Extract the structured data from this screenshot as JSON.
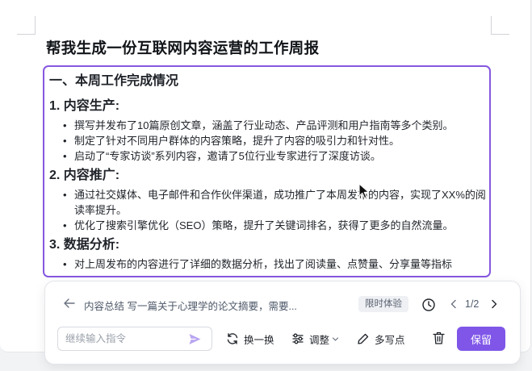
{
  "document": {
    "title": "帮我生成一份互联网内容运营的工作周报",
    "section_heading": "一、本周工作完成情况",
    "subsections": [
      {
        "heading": "1. 内容生产:",
        "bullets": [
          "撰写并发布了10篇原创文章，涵盖了行业动态、产品评测和用户指南等多个类别。",
          "制定了针对不同用户群体的内容策略，提升了内容的吸引力和针对性。",
          "启动了“专家访谈”系列内容，邀请了5位行业专家进行了深度访谈。"
        ]
      },
      {
        "heading": "2. 内容推广:",
        "bullets": [
          "通过社交媒体、电子邮件和合作伙伴渠道，成功推广了本周发布的内容，实现了XX%的阅读率提升。",
          "优化了搜索引擎优化（SEO）策略，提升了关键词排名，获得了更多的自然流量。"
        ]
      },
      {
        "heading": "3. 数据分析:",
        "bullets": [
          "对上周发布的内容进行了详细的数据分析，找出了阅读量、点赞量、分享量等指标"
        ]
      }
    ]
  },
  "ai_panel": {
    "prompt_preview": "内容总结 写一篇关于心理学的论文摘要，需要...",
    "badge": "限时体验",
    "pager": "1/2",
    "input_placeholder": "继续输入指令",
    "actions": {
      "rewrite": "换一换",
      "adjust": "调整",
      "more": "多写点",
      "save": "保留"
    }
  },
  "colors": {
    "accent": "#7f56e8",
    "selection_border": "#8657e0"
  },
  "icons": [
    "back-arrow-icon",
    "history-clock-icon",
    "chevron-left-icon",
    "chevron-right-icon",
    "send-icon",
    "refresh-icon",
    "sliders-icon",
    "chevron-down-icon",
    "pencil-icon",
    "trash-icon",
    "mouse-pointer-icon"
  ]
}
